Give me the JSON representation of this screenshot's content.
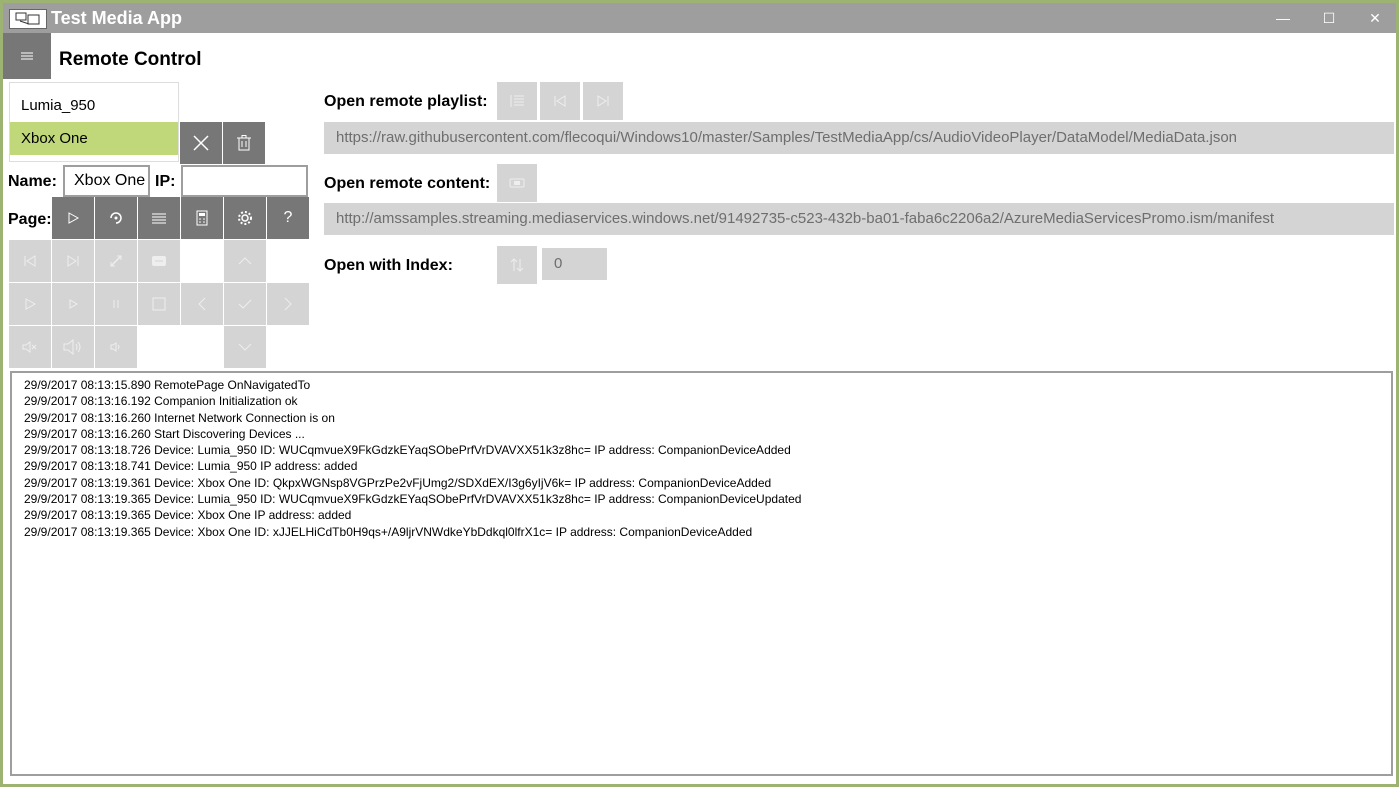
{
  "window": {
    "title": "Test Media App",
    "minimize": "—",
    "maximize": "☐",
    "close": "✕"
  },
  "page": {
    "title": "Remote Control"
  },
  "devices": {
    "items": [
      "Lumia_950",
      "Xbox One"
    ],
    "selected": "Xbox One"
  },
  "fields": {
    "name_label": "Name:",
    "name_value": "Xbox One",
    "ip_label": "IP:",
    "ip_value": "",
    "page_label": "Page:"
  },
  "remote": {
    "playlist_label": "Open remote playlist:",
    "playlist_url": "https://raw.githubusercontent.com/flecoqui/Windows10/master/Samples/TestMediaApp/cs/AudioVideoPlayer/DataModel/MediaData.json",
    "content_label": "Open remote content:",
    "content_url": "http://amssamples.streaming.mediaservices.windows.net/91492735-c523-432b-ba01-faba6c2206a2/AzureMediaServicesPromo.ism/manifest",
    "index_label": "Open with Index:",
    "index_value": "0"
  },
  "page_buttons": {
    "help": "?"
  },
  "log": [
    "29/9/2017 08:13:15.890 RemotePage OnNavigatedTo",
    "29/9/2017 08:13:16.192 Companion Initialization ok",
    "29/9/2017 08:13:16.260 Internet Network Connection is on",
    "29/9/2017 08:13:16.260 Start Discovering Devices ...",
    "29/9/2017 08:13:18.726 Device: Lumia_950 ID: WUCqmvueX9FkGdzkEYaqSObePrfVrDVAVXX51k3z8hc= IP address:  CompanionDeviceAdded",
    "29/9/2017 08:13:18.741 Device: Lumia_950 IP address:  added",
    "29/9/2017 08:13:19.361 Device: Xbox One ID: QkpxWGNsp8VGPrzPe2vFjUmg2/SDXdEX/I3g6yIjV6k= IP address:  CompanionDeviceAdded",
    "29/9/2017 08:13:19.365 Device: Lumia_950 ID: WUCqmvueX9FkGdzkEYaqSObePrfVrDVAVXX51k3z8hc= IP address:  CompanionDeviceUpdated",
    "29/9/2017 08:13:19.365 Device: Xbox One IP address:  added",
    "29/9/2017 08:13:19.365 Device: Xbox One ID: xJJELHiCdTb0H9qs+/A9ljrVNWdkeYbDdkql0lfrX1c= IP address:  CompanionDeviceAdded"
  ],
  "colors": {
    "titlebar": "#9e9e9e",
    "accent_selected": "#c0d87a",
    "button_dark": "#777777",
    "button_disabled": "#d4d4d4"
  }
}
